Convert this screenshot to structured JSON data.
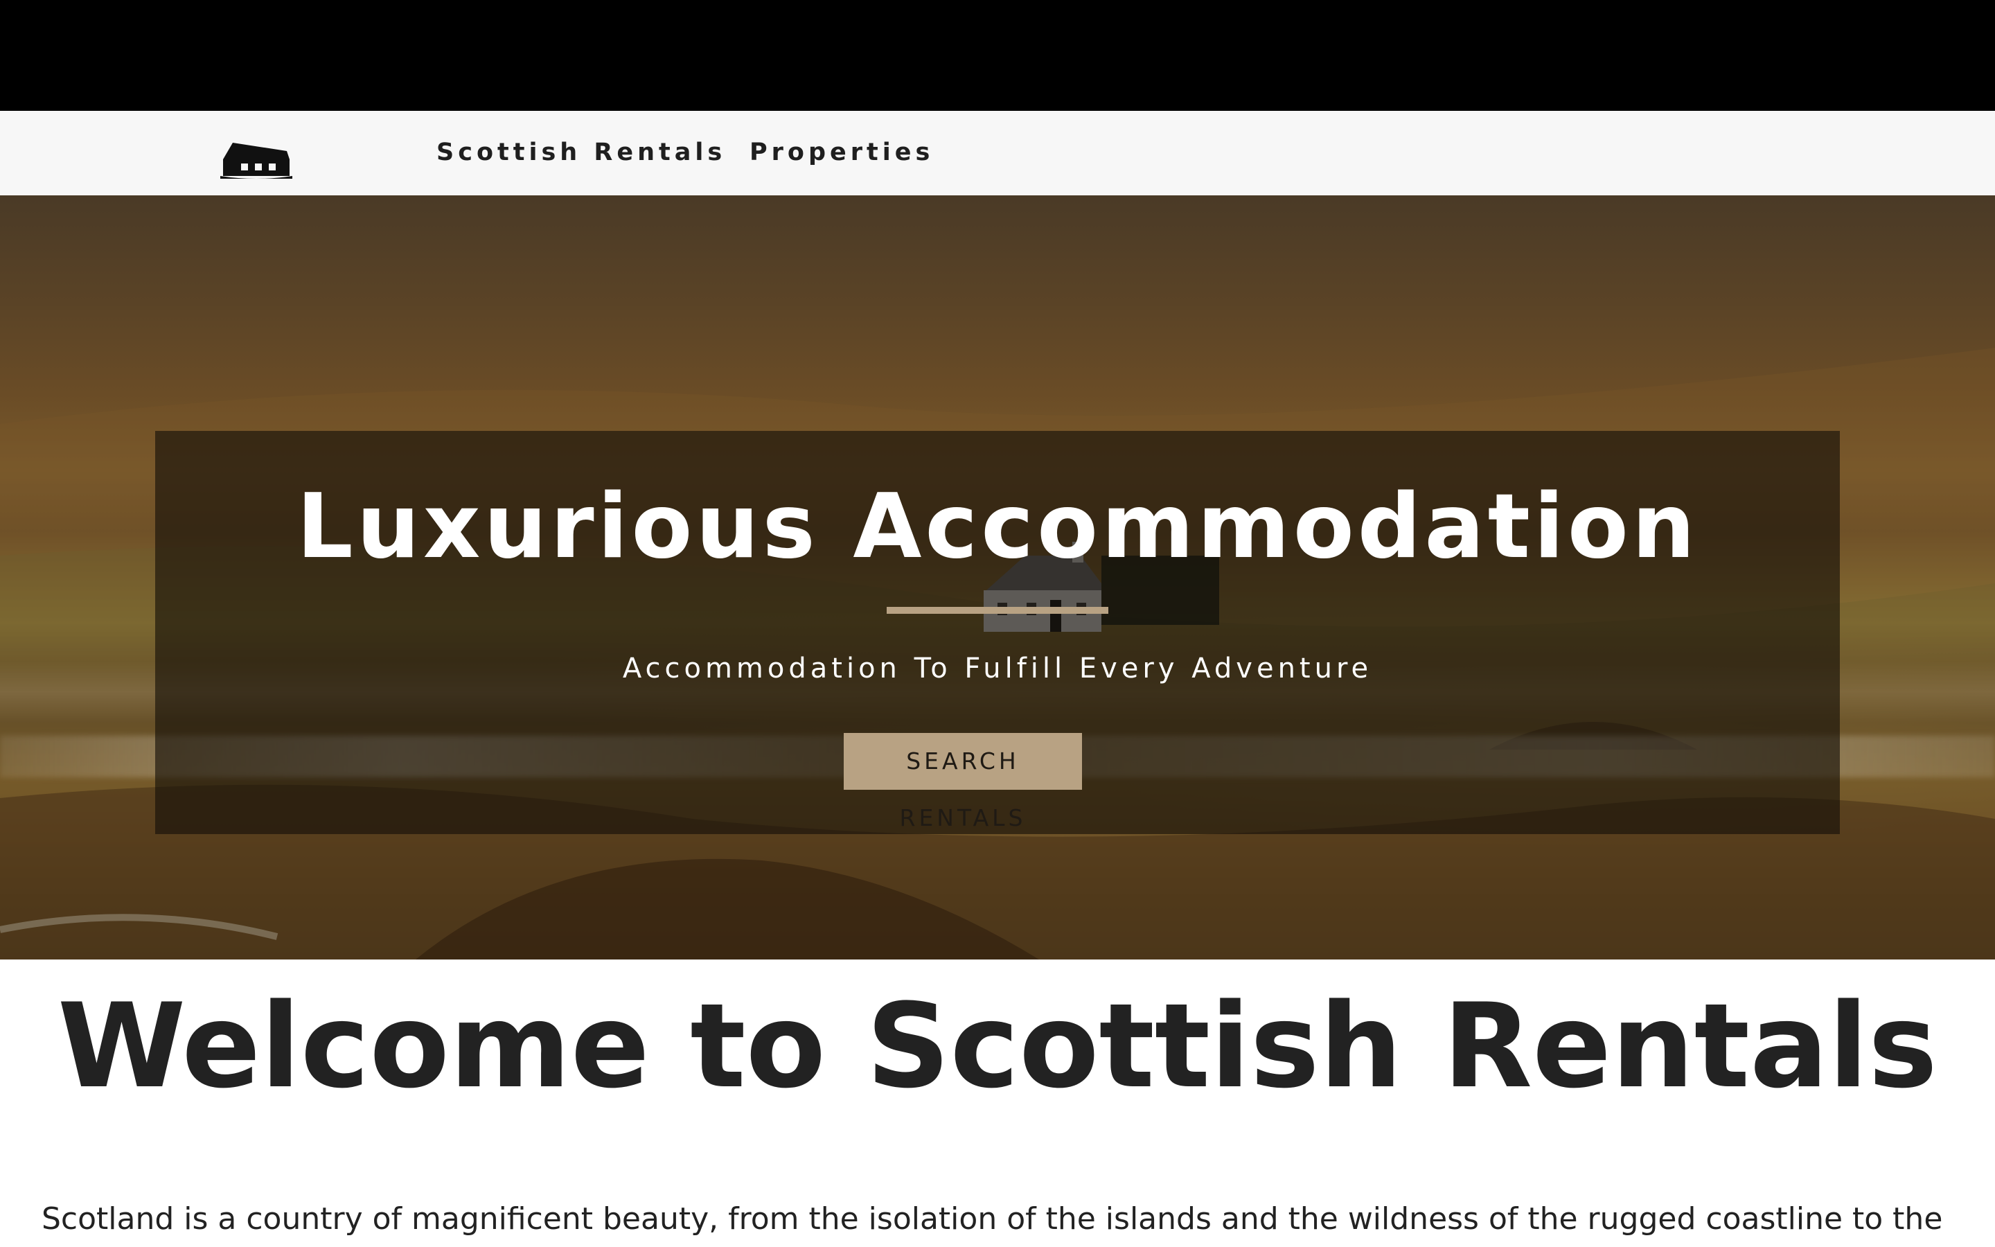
{
  "nav": {
    "logo_icon": "cottage-icon",
    "brand_label": "Scottish Rentals",
    "properties_label": "Properties"
  },
  "hero": {
    "background": "highland-landscape-photo",
    "title": "Luxurious Accommodation",
    "subtitle": "Accommodation To Fulfill Every Adventure",
    "button_label": "SEARCH RENTALS",
    "accent_color": "#b8a283"
  },
  "welcome": {
    "title": "Welcome to Scottish Rentals",
    "intro": "Scotland is a country of magnificent beauty, from the isolation of the islands and the wildness of the rugged coastline to the"
  },
  "colors": {
    "topbar": "#000000",
    "navbar": "#f7f7f7",
    "text": "#222222",
    "accent": "#b8a283"
  }
}
